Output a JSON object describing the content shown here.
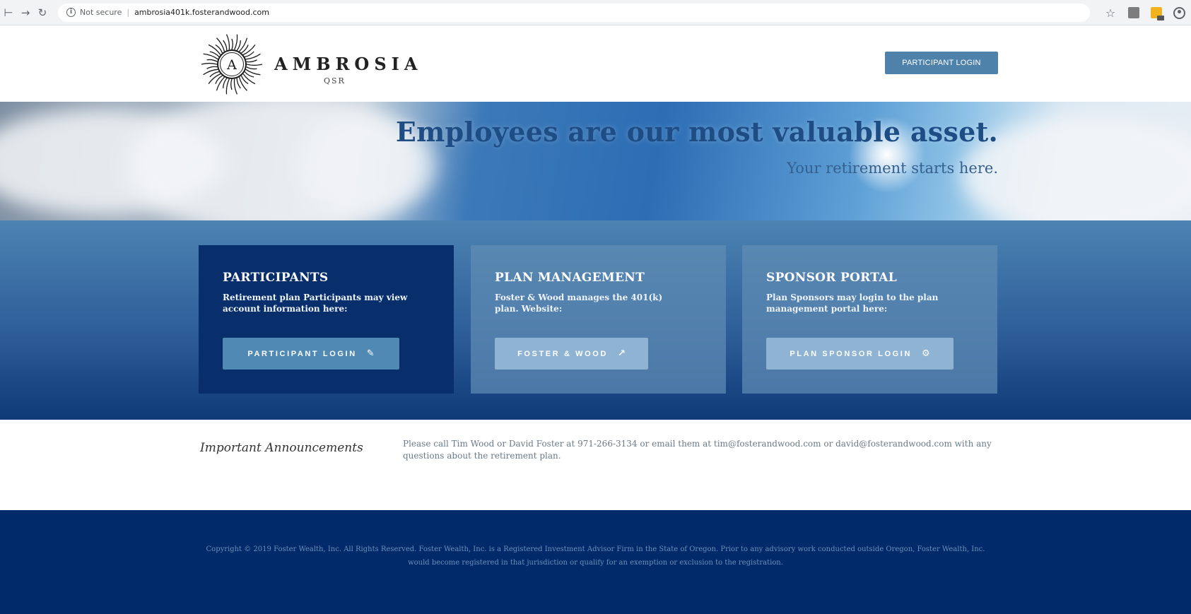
{
  "browser": {
    "security_label": "Not secure",
    "url": "ambrosia401k.fosterandwood.com"
  },
  "header": {
    "brand_name": "AMBROSIA",
    "brand_sub": "QSR",
    "logo_letter": "A",
    "login_label": "PARTICIPANT LOGIN"
  },
  "hero": {
    "title": "Employees are our most valuable asset.",
    "subtitle": "Your retirement starts here."
  },
  "cards": [
    {
      "title": "PARTICIPANTS",
      "desc": "Retirement plan Participants may view account information here:",
      "button": "PARTICIPANT LOGIN",
      "icon": "edit-icon"
    },
    {
      "title": "PLAN MANAGEMENT",
      "desc": "Foster & Wood manages the 401(k) plan. Website:",
      "button": "FOSTER & WOOD",
      "icon": "external-share-icon"
    },
    {
      "title": "SPONSOR PORTAL",
      "desc": "Plan Sponsors may login to the plan management portal here:",
      "button": "PLAN SPONSOR LOGIN",
      "icon": "gear-icon"
    }
  ],
  "announcements": {
    "title": "Important Announcements",
    "text": "Please call Tim Wood or David Foster at 971-266-3134 or email them at tim@fosterandwood.com or david@fosterandwood.com with any questions about the retirement plan."
  },
  "footer": {
    "copyright": "Copyright © 2019 Foster Wealth, Inc. All Rights Reserved. Foster Wealth, Inc. is a Registered Investment Advisor Firm in the State of Oregon. Prior to any advisory work conducted outside Oregon, Foster Wealth, Inc. would become registered in that jurisdiction or qualify for an exemption or exclusion to the registration."
  },
  "colors": {
    "brand_blue": "#4e82ab",
    "navy": "#002a6a",
    "card_dark": "#082f6c"
  }
}
